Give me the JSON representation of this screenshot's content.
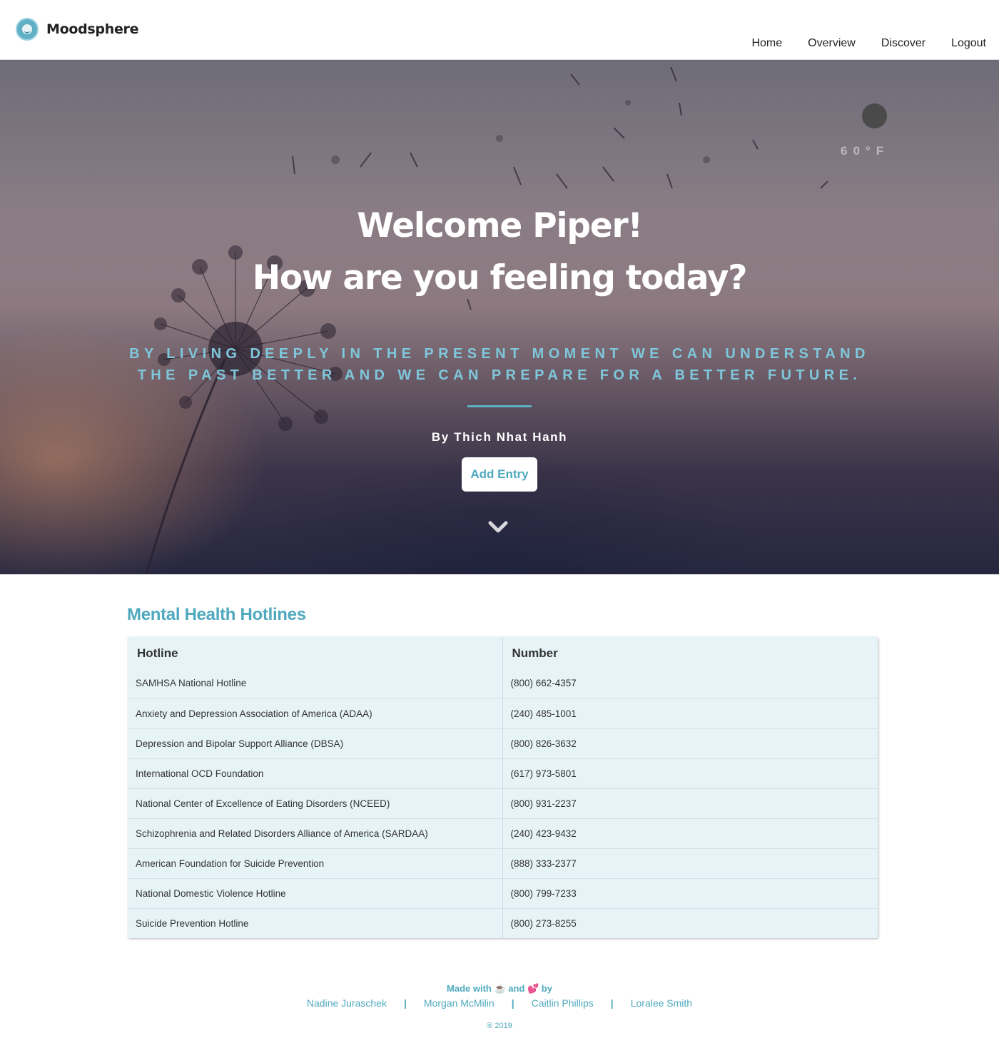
{
  "header": {
    "brand": "Moodsphere",
    "nav": [
      "Home",
      "Overview",
      "Discover",
      "Logout"
    ]
  },
  "hero": {
    "weather_temp": "60°F",
    "welcome_line1": "Welcome Piper!",
    "welcome_line2": "How are you feeling today?",
    "quote": "BY LIVING DEEPLY IN THE PRESENT MOMENT WE CAN UNDERSTAND THE PAST BETTER AND WE CAN PREPARE FOR A BETTER FUTURE.",
    "author": "By Thich Nhat Hanh",
    "add_entry_label": "Add Entry"
  },
  "hotlines": {
    "title": "Mental Health Hotlines",
    "columns": [
      "Hotline",
      "Number"
    ],
    "rows": [
      {
        "name": "SAMHSA National Hotline",
        "number": "(800) 662-4357"
      },
      {
        "name": "Anxiety and Depression Association of America (ADAA)",
        "number": "(240) 485-1001"
      },
      {
        "name": "Depression and Bipolar Support Alliance (DBSA)",
        "number": "(800) 826-3632"
      },
      {
        "name": "International OCD Foundation",
        "number": "(617) 973-5801"
      },
      {
        "name": "National Center of Excellence of Eating Disorders (NCEED)",
        "number": "(800) 931-2237"
      },
      {
        "name": "Schizophrenia and Related Disorders Alliance of America (SARDAA)",
        "number": "(240) 423-9432"
      },
      {
        "name": "American Foundation for Suicide Prevention",
        "number": "(888) 333-2377"
      },
      {
        "name": "National Domestic Violence Hotline",
        "number": "(800) 799-7233"
      },
      {
        "name": "Suicide Prevention Hotline",
        "number": "(800) 273-8255"
      }
    ]
  },
  "footer": {
    "made_with": "Made with ☕ and 💕 by",
    "authors": [
      "Nadine Juraschek",
      "Morgan McMilin",
      "Caitlin Phillips",
      "Loralee Smith"
    ],
    "separator": "|",
    "copyright": "® 2019"
  },
  "colors": {
    "accent": "#4fa9be",
    "table_bg": "#e6f4f7",
    "quote": "#7fc7db"
  }
}
